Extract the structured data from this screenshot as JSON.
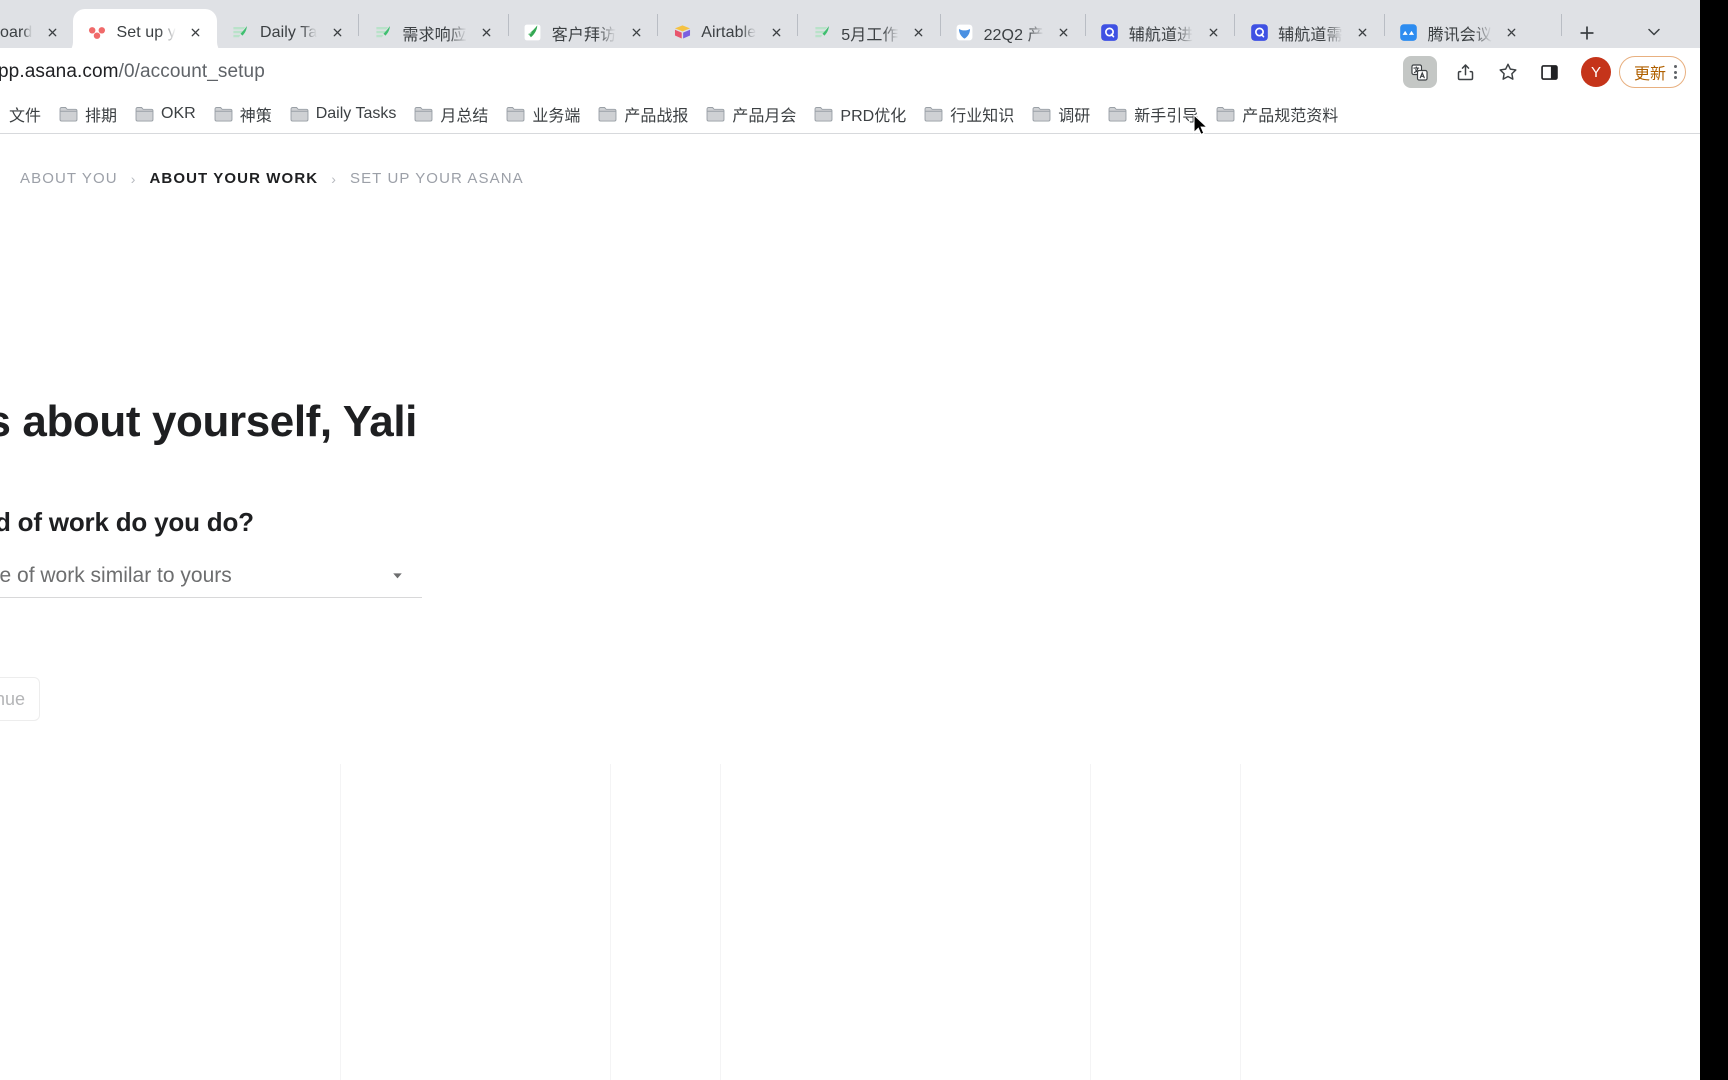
{
  "browser": {
    "tabs": [
      {
        "title": "oard",
        "favicon": "generic-page-icon",
        "favicon_color": "#bdbdbd",
        "active": false,
        "clipped_left": true
      },
      {
        "title": "Set up y",
        "favicon": "asana-icon",
        "favicon_color": "#f06a6a",
        "active": true
      },
      {
        "title": "Daily Ta",
        "favicon": "tencent-docs-icon",
        "favicon_color": "#7fc49a",
        "active": false
      },
      {
        "title": "需求响应",
        "favicon": "tencent-docs-icon",
        "favicon_color": "#7fc49a",
        "active": false
      },
      {
        "title": "客户拜访",
        "favicon": "tencent-docs-sheet-icon",
        "favicon_color": "#34a853",
        "active": false
      },
      {
        "title": "Airtable",
        "favicon": "airtable-icon",
        "favicon_color": "#f5b301",
        "active": false
      },
      {
        "title": "5月工作",
        "favicon": "tencent-docs-icon",
        "favicon_color": "#7fc49a",
        "active": false
      },
      {
        "title": "22Q2 产",
        "favicon": "tencent-meeting-doc-icon",
        "favicon_color": "#4a90e2",
        "active": false
      },
      {
        "title": "辅航道进",
        "favicon": "q-app-icon",
        "favicon_color": "#3f51e3",
        "active": false
      },
      {
        "title": "辅航道需",
        "favicon": "q-app-icon",
        "favicon_color": "#3f51e3",
        "active": false
      },
      {
        "title": "腾讯会议",
        "favicon": "tencent-meeting-icon",
        "favicon_color": "#2d8cf0",
        "active": false
      }
    ],
    "new_tab_label": "+",
    "tab_list_chevron": "chevron-down-icon",
    "url": {
      "host": "pp.asana.com",
      "path": "/0/account_setup"
    },
    "toolbar": {
      "translate_icon": "translate-icon",
      "share_icon": "share-icon",
      "bookmark_icon": "star-icon",
      "side_panel_icon": "side-panel-icon",
      "avatar_initial": "Y",
      "avatar_color": "#c5341a",
      "update_label": "更新",
      "menu_icon": "kebab-menu-icon"
    },
    "bookmarks": [
      {
        "label": "文件",
        "icon": "folder-icon",
        "clipped_left": true
      },
      {
        "label": "排期",
        "icon": "folder-icon"
      },
      {
        "label": "OKR",
        "icon": "folder-icon"
      },
      {
        "label": "神策",
        "icon": "folder-icon"
      },
      {
        "label": "Daily Tasks",
        "icon": "folder-icon"
      },
      {
        "label": "月总结",
        "icon": "folder-icon"
      },
      {
        "label": "业务端",
        "icon": "folder-icon"
      },
      {
        "label": "产品战报",
        "icon": "folder-icon"
      },
      {
        "label": "产品月会",
        "icon": "folder-icon"
      },
      {
        "label": "PRD优化",
        "icon": "folder-icon"
      },
      {
        "label": "行业知识",
        "icon": "folder-icon"
      },
      {
        "label": "调研",
        "icon": "folder-icon"
      },
      {
        "label": "新手引导",
        "icon": "folder-icon"
      },
      {
        "label": "产品规范资料",
        "icon": "folder-icon"
      }
    ]
  },
  "page": {
    "breadcrumb": [
      {
        "label": "ABOUT YOU",
        "current": false
      },
      {
        "label": "ABOUT YOUR WORK",
        "current": true
      },
      {
        "label": "SET UP YOUR ASANA",
        "current": false
      }
    ],
    "breadcrumb_separator": "›",
    "headline": "us about yourself, Yali",
    "question": "kind of work do you do?",
    "work_type_select": {
      "value": "a type of work similar to yours",
      "caret_icon": "chevron-down-icon"
    },
    "continue_button": "nue"
  },
  "colors": {
    "accent": "#f06a6a",
    "chrome_bg": "#dfe1e5",
    "text_primary": "#1e1f21",
    "text_muted": "#9ca0a8",
    "update_pill": "#b06000"
  }
}
